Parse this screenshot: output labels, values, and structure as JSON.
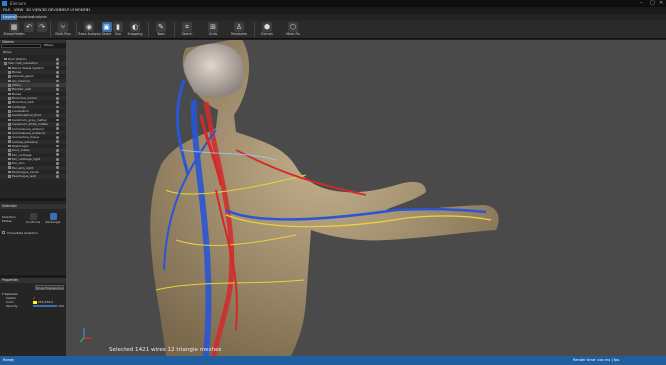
{
  "window": {
    "title": "Elenium"
  },
  "menu": [
    "FILE",
    "VIEW",
    "3D VIEW",
    "3D DEVICE",
    "HELP",
    "UI MODES",
    "H"
  ],
  "tabs": [
    {
      "label": "Layers",
      "active": true
    },
    {
      "label": "Simulation",
      "active": false
    },
    {
      "label": "Analysis",
      "active": false
    }
  ],
  "ribbon": [
    {
      "label": "Show/Hidden",
      "icon": "layers-icon"
    },
    {
      "label": "Undo",
      "icon": "undo-icon"
    },
    {
      "label": "Redo",
      "icon": "redo-icon"
    },
    {
      "label": "Multi-Pins",
      "icon": "multi-pins-icon"
    },
    {
      "label": "Trace Analysis",
      "icon": "trace-analysis-icon"
    },
    {
      "label": "Select",
      "icon": "select-icon",
      "selected": true
    },
    {
      "label": "Sun",
      "icon": "sun-icon"
    },
    {
      "label": "Snapping",
      "icon": "snapping-icon"
    },
    {
      "label": "Tools",
      "icon": "tools-icon"
    },
    {
      "label": "Sketch",
      "icon": "sketch-icon"
    },
    {
      "label": "Grids",
      "icon": "grids-icon"
    },
    {
      "label": "Templates",
      "icon": "templates-icon"
    },
    {
      "label": "Extract",
      "icon": "extract-icon"
    },
    {
      "label": "Mesh Fix",
      "icon": "mesh-fix-icon"
    }
  ],
  "tree_panel": {
    "header": "Objects",
    "filter_label": "Filters",
    "section": "Wires",
    "items": [
      {
        "label": "Root (fabric)",
        "depth": 0,
        "checked": true
      },
      {
        "label": "Vein cust_insulation",
        "depth": 0,
        "checked": true
      },
      {
        "label": "Nerve Vessel System",
        "depth": 1,
        "checked": true
      },
      {
        "label": "Bones",
        "depth": 1,
        "checked": true
      },
      {
        "label": "Adrenal_gland",
        "depth": 1,
        "checked": true
      },
      {
        "label": "Alv_internal",
        "depth": 1,
        "checked": true
      },
      {
        "label": "Artery",
        "depth": 1,
        "checked": true
      },
      {
        "label": "Bladder_wall",
        "depth": 1,
        "checked": true
      },
      {
        "label": "Bones",
        "depth": 1,
        "checked": true
      },
      {
        "label": "Bronchus_lumen",
        "depth": 1,
        "checked": true
      },
      {
        "label": "Bronchus_wall",
        "depth": 1,
        "checked": true
      },
      {
        "label": "Cartilage",
        "depth": 1,
        "checked": true
      },
      {
        "label": "Cerebellum",
        "depth": 1,
        "checked": true
      },
      {
        "label": "Cerebrospinal_fluid",
        "depth": 1,
        "checked": true
      },
      {
        "label": "Cerebrum_grey_matter",
        "depth": 1,
        "checked": true
      },
      {
        "label": "Cerebrum_white_matter",
        "depth": 1,
        "checked": true
      },
      {
        "label": "Commissura_anterior",
        "depth": 1,
        "checked": true
      },
      {
        "label": "Commissura_posterior",
        "depth": 1,
        "checked": true
      },
      {
        "label": "Connective_tissue",
        "depth": 1,
        "checked": true
      },
      {
        "label": "Cornea_adhesive",
        "depth": 1,
        "checked": true
      },
      {
        "label": "Diaphragm",
        "depth": 1,
        "checked": true
      },
      {
        "label": "Dura_mater",
        "depth": 1,
        "checked": true
      },
      {
        "label": "Ear_cartilage",
        "depth": 1,
        "checked": true
      },
      {
        "label": "Ear_cartilage_right",
        "depth": 1,
        "checked": true
      },
      {
        "label": "Ear_skin",
        "depth": 1,
        "checked": true
      },
      {
        "label": "Ear_skin_right",
        "depth": 1,
        "checked": true
      },
      {
        "label": "Esophagus_lumen",
        "depth": 1,
        "checked": true
      },
      {
        "label": "Esophagus_wall",
        "depth": 1,
        "checked": true
      }
    ]
  },
  "selection_panel": {
    "header": "Selection",
    "mode_label": "Selection Modes",
    "modes": [
      {
        "label": "Conforms",
        "selected": false
      },
      {
        "label": "Rectangle",
        "selected": true
      }
    ],
    "checkbox": "Immediate Selection"
  },
  "properties_panel": {
    "header": "Properties",
    "button": "Show Expressions",
    "group": "Selection",
    "rows": [
      {
        "label": "Visible",
        "value": "✓"
      },
      {
        "label": "Color",
        "value": "255,255,0"
      },
      {
        "label": "Opacity",
        "value": "100"
      }
    ]
  },
  "viewport": {
    "status_text": "Selected 1421 wires 12 triangle meshes",
    "colors": {
      "body": "#b8a27a",
      "artery": "#d42a2a",
      "vein": "#2a55d4",
      "nerve": "#e8d23a"
    }
  },
  "statusbar": {
    "left": "Ready",
    "right": "Render time: xxx ms | fps"
  }
}
